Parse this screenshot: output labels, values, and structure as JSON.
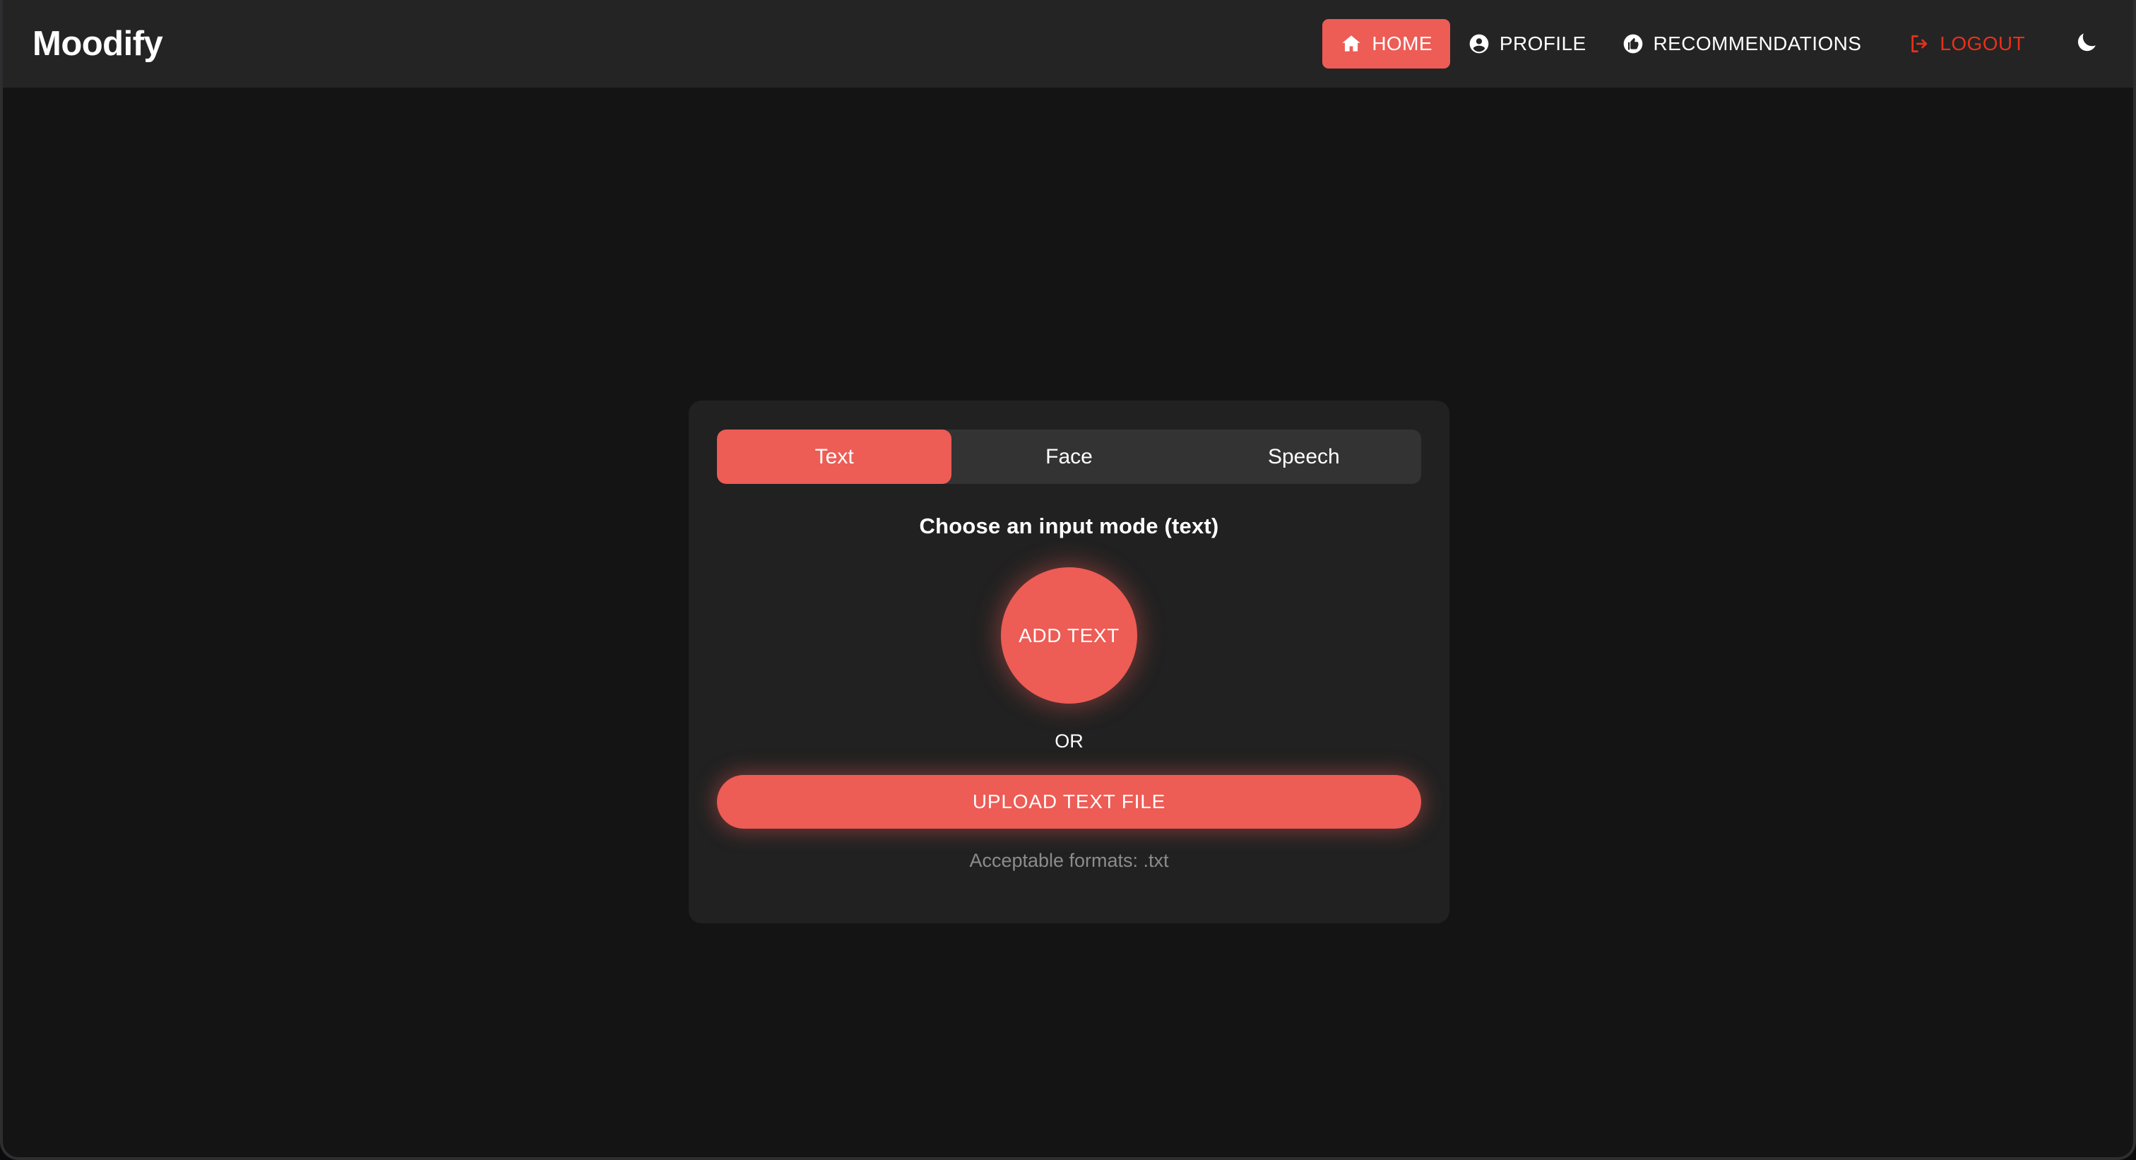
{
  "app": {
    "brand": "Moodify",
    "accent_color": "#ed5c55",
    "logout_color": "#e8301a",
    "header_bg": "#242424",
    "page_bg": "#141414",
    "card_bg": "#212121",
    "tabbar_bg": "#333333",
    "muted_text_color": "#8c8c8c"
  },
  "nav": {
    "items": [
      {
        "label": "HOME",
        "icon": "home-icon",
        "active": true
      },
      {
        "label": "PROFILE",
        "icon": "account-circle-icon",
        "active": false
      },
      {
        "label": "RECOMMENDATIONS",
        "icon": "thumb-up-circle-icon",
        "active": false
      },
      {
        "label": "LOGOUT",
        "icon": "logout-icon",
        "active": false
      }
    ],
    "theme_toggle": {
      "icon": "moon-icon",
      "state": "dark"
    }
  },
  "card": {
    "tabs": [
      {
        "label": "Text",
        "active": true
      },
      {
        "label": "Face",
        "active": false
      },
      {
        "label": "Speech",
        "active": false
      }
    ],
    "mode_title": "Choose an input mode (text)",
    "add_button_label": "ADD TEXT",
    "or_label": "OR",
    "upload_button_label": "UPLOAD TEXT FILE",
    "formats_note": "Acceptable formats: .txt"
  }
}
